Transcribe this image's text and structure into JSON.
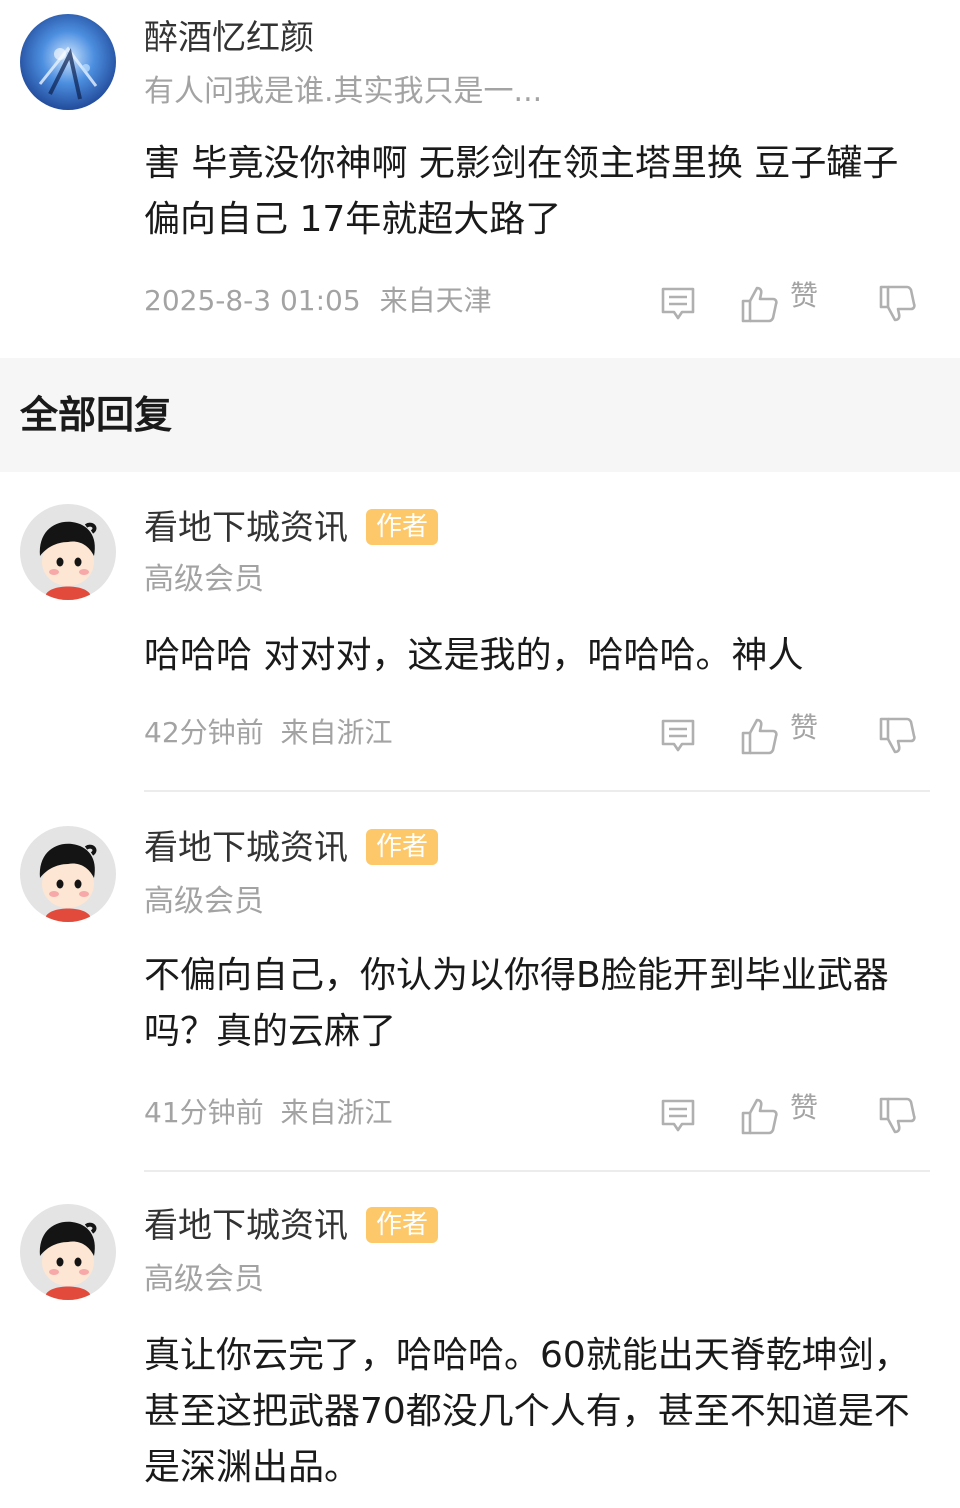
{
  "main_comment": {
    "author": "醉酒忆红颜",
    "signature": "有人问我是谁.其实我只是一...",
    "text": "害 毕竟没你神啊 无影剑在领主塔里换 豆子罐子偏向自己 17年就超大路了",
    "time": "2025-8-3 01:05",
    "location": "来自天津",
    "like_label": "赞"
  },
  "section": {
    "title": "全部回复"
  },
  "replies": [
    {
      "author": "看地下城资讯",
      "badge": "作者",
      "level": "高级会员",
      "text": "哈哈哈 对对对，这是我的，哈哈哈。神人",
      "time": "42分钟前",
      "location": "来自浙江",
      "like_label": "赞"
    },
    {
      "author": "看地下城资讯",
      "badge": "作者",
      "level": "高级会员",
      "text": "不偏向自己，你认为以你得B脸能开到毕业武器吗？真的云麻了",
      "time": "41分钟前",
      "location": "来自浙江",
      "like_label": "赞"
    },
    {
      "author": "看地下城资讯",
      "badge": "作者",
      "level": "高级会员",
      "text": "真让你云完了，哈哈哈。60就能出天脊乾坤剑，甚至这把武器70都没几个人有，甚至不知道是不是深渊出品。"
    }
  ],
  "colors": {
    "badge": "#fcc86a",
    "section_bg": "#f6f6f6",
    "muted": "#a3a3a3"
  },
  "icons": [
    "reply-icon",
    "thumbs-up-icon",
    "thumbs-down-icon"
  ]
}
